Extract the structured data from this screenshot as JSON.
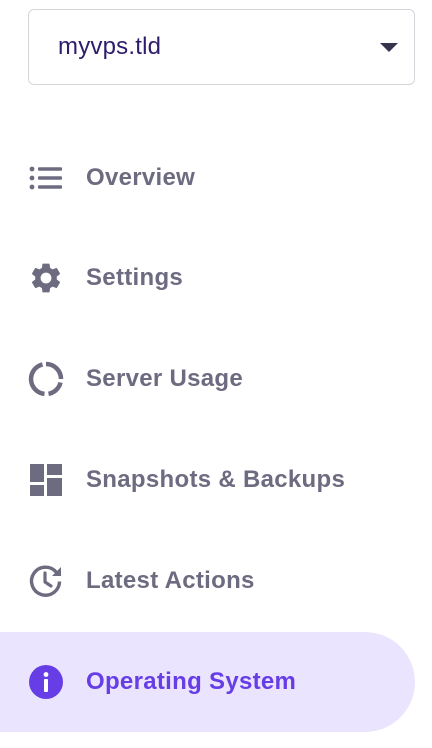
{
  "server_select": {
    "value": "myvps.tld"
  },
  "nav": {
    "items": [
      {
        "label": "Overview",
        "icon": "list-icon"
      },
      {
        "label": "Settings",
        "icon": "gear-icon"
      },
      {
        "label": "Server Usage",
        "icon": "donut-chart-icon"
      },
      {
        "label": "Snapshots & Backups",
        "icon": "dashboard-grid-icon"
      },
      {
        "label": "Latest Actions",
        "icon": "clock-history-icon"
      },
      {
        "label": "Operating System",
        "icon": "info-icon",
        "active": true
      }
    ]
  },
  "colors": {
    "text_muted": "#6d6b80",
    "accent": "#673de6",
    "active_bg": "#ebe4ff",
    "select_text": "#2f1c6a"
  }
}
